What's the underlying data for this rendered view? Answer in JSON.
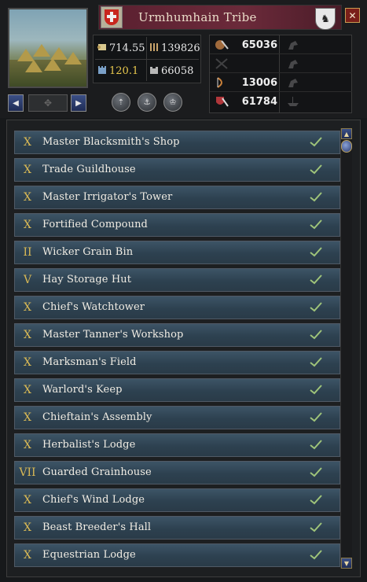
{
  "header": {
    "title": "Urmhumhain Tribe",
    "close_label": "✕",
    "rank_label": "♞"
  },
  "navigation": {
    "prev_label": "◀",
    "next_label": "▶"
  },
  "stats": {
    "wealth": "714.55",
    "manpower": "139826",
    "levy": "120.1",
    "garrison": "66058"
  },
  "actions": [
    "tax-action",
    "levy-action",
    "build-action"
  ],
  "military": {
    "light_infantry": "65036",
    "heavy_infantry": "13006",
    "knights": "61784"
  },
  "buildings": [
    {
      "level": "X",
      "name": "Master Blacksmith's Shop"
    },
    {
      "level": "X",
      "name": "Trade Guildhouse"
    },
    {
      "level": "X",
      "name": "Master Irrigator's Tower"
    },
    {
      "level": "X",
      "name": "Fortified Compound"
    },
    {
      "level": "II",
      "name": "Wicker Grain Bin"
    },
    {
      "level": "V",
      "name": "Hay Storage Hut"
    },
    {
      "level": "X",
      "name": "Chief's Watchtower"
    },
    {
      "level": "X",
      "name": "Master Tanner's Workshop"
    },
    {
      "level": "X",
      "name": "Marksman's Field"
    },
    {
      "level": "X",
      "name": "Warlord's Keep"
    },
    {
      "level": "X",
      "name": "Chieftain's Assembly"
    },
    {
      "level": "X",
      "name": "Herbalist's Lodge"
    },
    {
      "level": "VII",
      "name": "Guarded Grainhouse"
    },
    {
      "level": "X",
      "name": "Chief's Wind Lodge"
    },
    {
      "level": "X",
      "name": "Beast Breeder's Hall"
    },
    {
      "level": "X",
      "name": "Equestrian Lodge"
    }
  ],
  "colors": {
    "level_gold": "#d9b955",
    "check_green": "#9fc47a",
    "title_red": "#6b2a3a"
  }
}
